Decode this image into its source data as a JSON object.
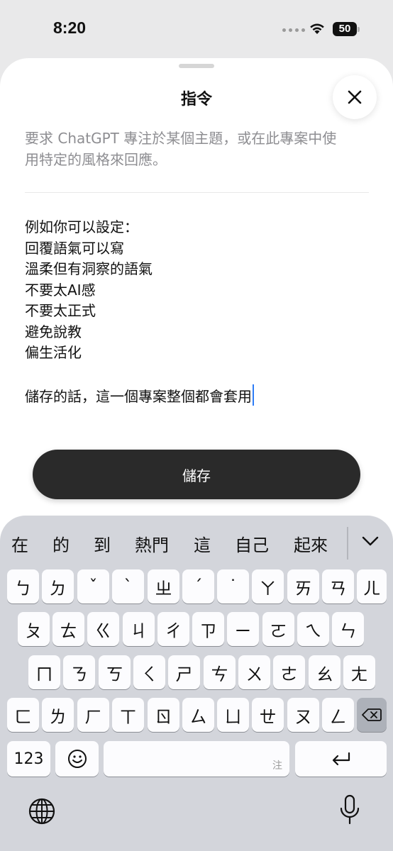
{
  "status": {
    "time": "8:20",
    "battery": "50"
  },
  "sheet": {
    "title": "指令",
    "description": "要求 ChatGPT 專注於某個主題，或在此專案中使用特定的風格來回應。",
    "instruction_lines": [
      "例如你可以設定：",
      "回覆語氣可以寫",
      "溫柔但有洞察的語氣",
      "不要太AI感",
      "不要太正式",
      "避免說教",
      "偏生活化",
      "",
      "儲存的話，這一個專案整個都會套用"
    ],
    "save_label": "儲存"
  },
  "keyboard": {
    "candidates": [
      "在",
      "的",
      "到",
      "熱門",
      "這",
      "自己",
      "起來"
    ],
    "rows": [
      [
        "ㄅ",
        "ㄉ",
        "ˇ",
        "ˋ",
        "ㄓ",
        "ˊ",
        "˙",
        "ㄚ",
        "ㄞ",
        "ㄢ",
        "ㄦ"
      ],
      [
        "ㄆ",
        "ㄊ",
        "ㄍ",
        "ㄐ",
        "ㄔ",
        "ㄗ",
        "ㄧ",
        "ㄛ",
        "ㄟ",
        "ㄣ"
      ],
      [
        "ㄇ",
        "ㄋ",
        "ㄎ",
        "ㄑ",
        "ㄕ",
        "ㄘ",
        "ㄨ",
        "ㄜ",
        "ㄠ",
        "ㄤ"
      ],
      [
        "ㄈ",
        "ㄌ",
        "ㄏ",
        "ㄒ",
        "ㄖ",
        "ㄙ",
        "ㄩ",
        "ㄝ",
        "ㄡ",
        "ㄥ"
      ]
    ],
    "numbers_label": "123",
    "space_label": "注",
    "icons": {
      "emoji": "emoji-icon",
      "delete": "delete-icon",
      "return": "return-icon",
      "globe": "globe-icon",
      "mic": "mic-icon",
      "chevron": "chevron-down-icon"
    }
  }
}
